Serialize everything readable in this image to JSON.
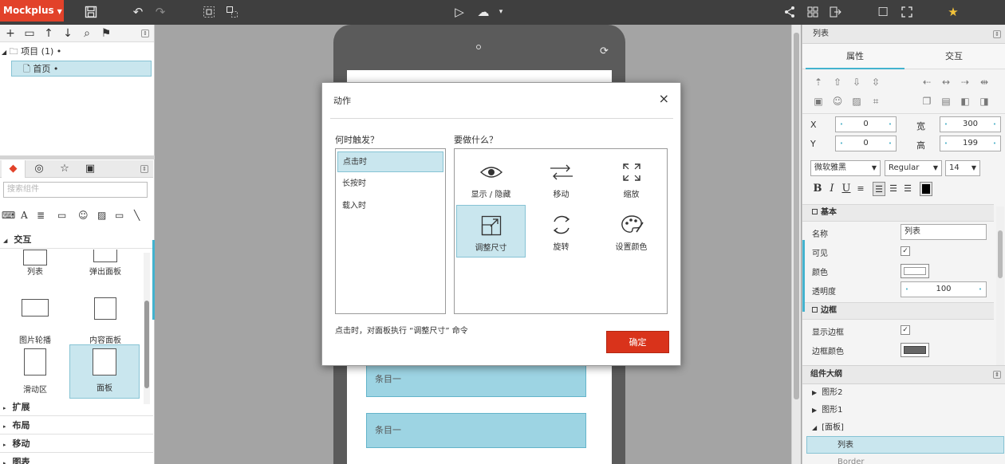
{
  "app": {
    "name": "Mockplus"
  },
  "left": {
    "tree": {
      "project": "项目 (1)",
      "page": "首页"
    },
    "lib_search_placeholder": "搜索组件",
    "sections": {
      "interaction": "交互",
      "extend": "扩展",
      "layout": "布局",
      "mobile": "移动",
      "chart": "图表"
    },
    "widgets": [
      "列表",
      "弹出面板",
      "图片轮播",
      "内容面板",
      "滑动区",
      "面板"
    ]
  },
  "canvas": {
    "list_items": [
      "条目一",
      "条目一"
    ]
  },
  "dialog": {
    "title": "动作",
    "close": "×",
    "event_question": "何时触发？",
    "action_question": "要做什么？",
    "events": [
      "点击时",
      "长按时",
      "载入时"
    ],
    "actions": [
      "显示 / 隐藏",
      "移动",
      "缩放",
      "调整尺寸",
      "旋转",
      "设置颜色"
    ],
    "hint": "点击时，对面板执行 “调整尺寸” 命令",
    "ok": "确定"
  },
  "right": {
    "header": "列表",
    "tabs": [
      "属性",
      "交互"
    ],
    "x_label": "X",
    "y_label": "Y",
    "w_label": "宽",
    "h_label": "高",
    "x": "0",
    "y": "0",
    "w": "300",
    "h": "199",
    "font": "微软雅黑",
    "style": "Regular",
    "size": "14",
    "basic_section": "基本",
    "name_label": "名称",
    "name_value": "列表",
    "visible_label": "可见",
    "color_label": "颜色",
    "opacity_label": "透明度",
    "opacity_value": "100",
    "border_section": "边框",
    "show_border_label": "显示边框",
    "border_color_label": "边框颜色",
    "outline_header": "组件大纲",
    "outline": [
      "图形2",
      "图形1",
      "[面板]",
      "列表",
      "Border"
    ]
  },
  "colors": {
    "brand": "#e2422a",
    "accent": "#43b3cf",
    "selection": "#c9e6ee",
    "ok": "#d9331b"
  }
}
